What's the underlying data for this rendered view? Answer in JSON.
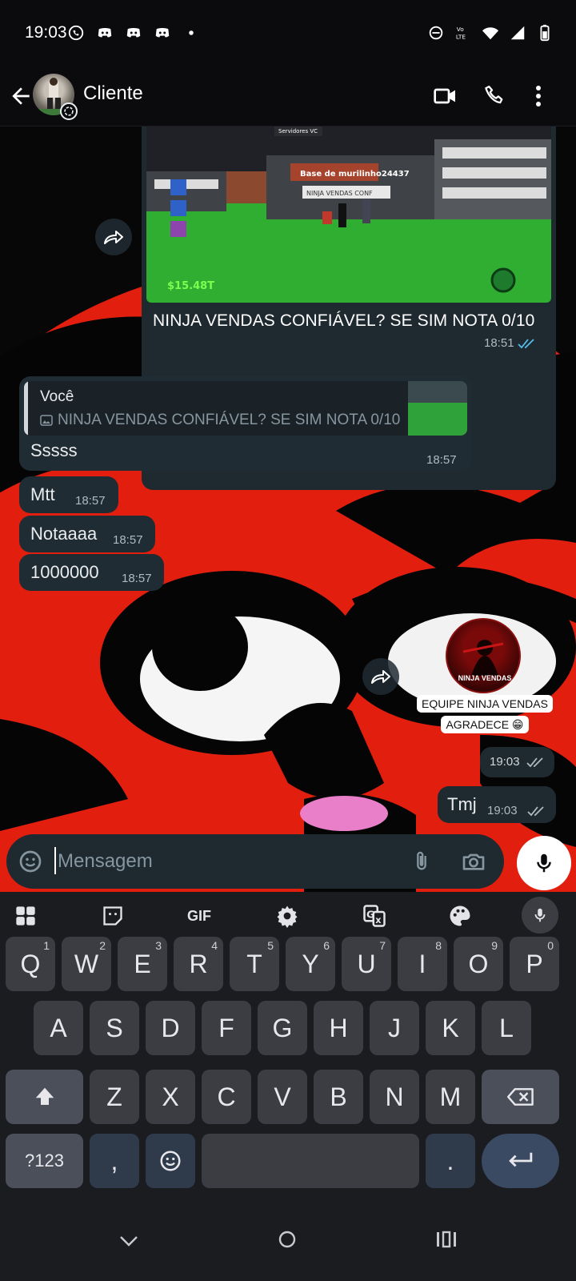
{
  "status_bar": {
    "time": "19:03"
  },
  "header": {
    "contact_name": "Cliente"
  },
  "messages": {
    "image_caption": "NINJA VENDAS CONFIÁVEL? SE SIM NOTA 0/10",
    "image_time": "18:51",
    "game_money": "$15.48T",
    "game_base_sign": "Base de murilinho24437",
    "game_servers": "Servidores VC",
    "reply_author": "Você",
    "reply_quote": "NINJA VENDAS CONFIÁVEL? SE SIM NOTA 0/10",
    "reply_text": "Sssss",
    "reply_time": "18:57",
    "msg_mtt": "Mtt",
    "msg_mtt_time": "18:57",
    "msg_notaaaa": "Notaaaa",
    "msg_notaaaa_time": "18:57",
    "msg_1000000": "1000000",
    "msg_1000000_time": "18:57",
    "sticker_label": "NINJA VENDAS",
    "sticker_text_1": "EQUIPE NINJA VENDAS",
    "sticker_text_2": "AGRADECE 😁",
    "sticker_time": "19:03",
    "tmj": "Tmj",
    "tmj_time": "19:03"
  },
  "composer": {
    "placeholder": "Mensagem"
  },
  "keyboard": {
    "gif_label": "GIF",
    "row1": [
      "Q",
      "W",
      "E",
      "R",
      "T",
      "Y",
      "U",
      "I",
      "O",
      "P"
    ],
    "row1_sup": [
      "1",
      "2",
      "3",
      "4",
      "5",
      "6",
      "7",
      "8",
      "9",
      "0"
    ],
    "row2": [
      "A",
      "S",
      "D",
      "F",
      "G",
      "H",
      "J",
      "K",
      "L"
    ],
    "row3": [
      "Z",
      "X",
      "C",
      "V",
      "B",
      "N",
      "M"
    ],
    "symbols_label": "?123",
    "comma": ",",
    "period": "."
  },
  "colors": {
    "bubble_in": "#202c33",
    "bubble_out": "#1f2a30",
    "read_ticks": "#53bdeb",
    "wallpaper_red": "#e21f0e"
  }
}
